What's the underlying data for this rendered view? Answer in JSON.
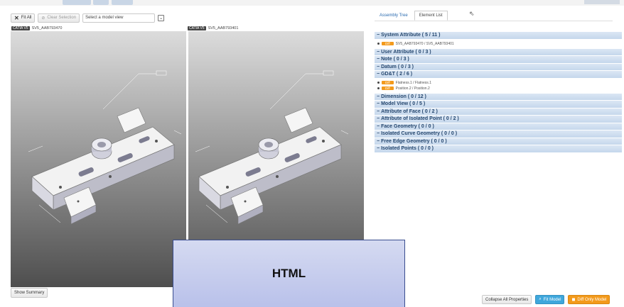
{
  "toolbar": {
    "fit_all": "Fit All",
    "clear_selection": "Clear Selection",
    "model_view_placeholder": "Select a model view"
  },
  "models": {
    "left": {
      "tag": "CATIA V5",
      "name": "SV5_AAB793470"
    },
    "right": {
      "tag": "CATIA V5",
      "name": "SV5_AAB793401"
    }
  },
  "show_summary": "Show Summary",
  "tabs": {
    "assembly_tree": "Assembly Tree",
    "element_list": "Element List"
  },
  "sections": [
    {
      "label": "System Attribute ( 5 / 11 )"
    },
    {
      "label": "User Attribute ( 0 / 3 )"
    },
    {
      "label": "Note ( 0 / 3 )"
    },
    {
      "label": "Datum ( 0 / 3 )"
    },
    {
      "label": "GD&T ( 2 / 6 )"
    },
    {
      "label": "Dimension ( 0 / 12 )"
    },
    {
      "label": "Model View ( 0 / 5 )"
    },
    {
      "label": "Attribute of Face ( 0 / 2 )"
    },
    {
      "label": "Attribute of Isolated Point ( 0 / 2 )"
    },
    {
      "label": "Face Geometry ( 0 / 0 )"
    },
    {
      "label": "Isolated Curve Geometry ( 0 / 0 )"
    },
    {
      "label": "Free Edge Geometry ( 0 / 0 )"
    },
    {
      "label": "Isolated Points ( 0 / 0 )"
    }
  ],
  "system_attribute_items": [
    {
      "badge": "Diff",
      "text": "SV5_AAB793470 / SV5_AAB793401"
    }
  ],
  "gdt_items": [
    {
      "badge": "Diff",
      "text": "Flatness.1 / Flatness.1"
    },
    {
      "badge": "Diff",
      "text": "Position.2 / Position.2"
    }
  ],
  "bottom_buttons": {
    "collapse": "Collapse All Properties",
    "fit_model": "Fit Model",
    "diff_only": "Diff Only Model"
  },
  "overlay_label": "HTML",
  "colors": {
    "section_bg": "#c5d7ec",
    "badge": "#f39a1b",
    "blue_button": "#3fa7dc",
    "orange_button": "#f39a1b"
  }
}
